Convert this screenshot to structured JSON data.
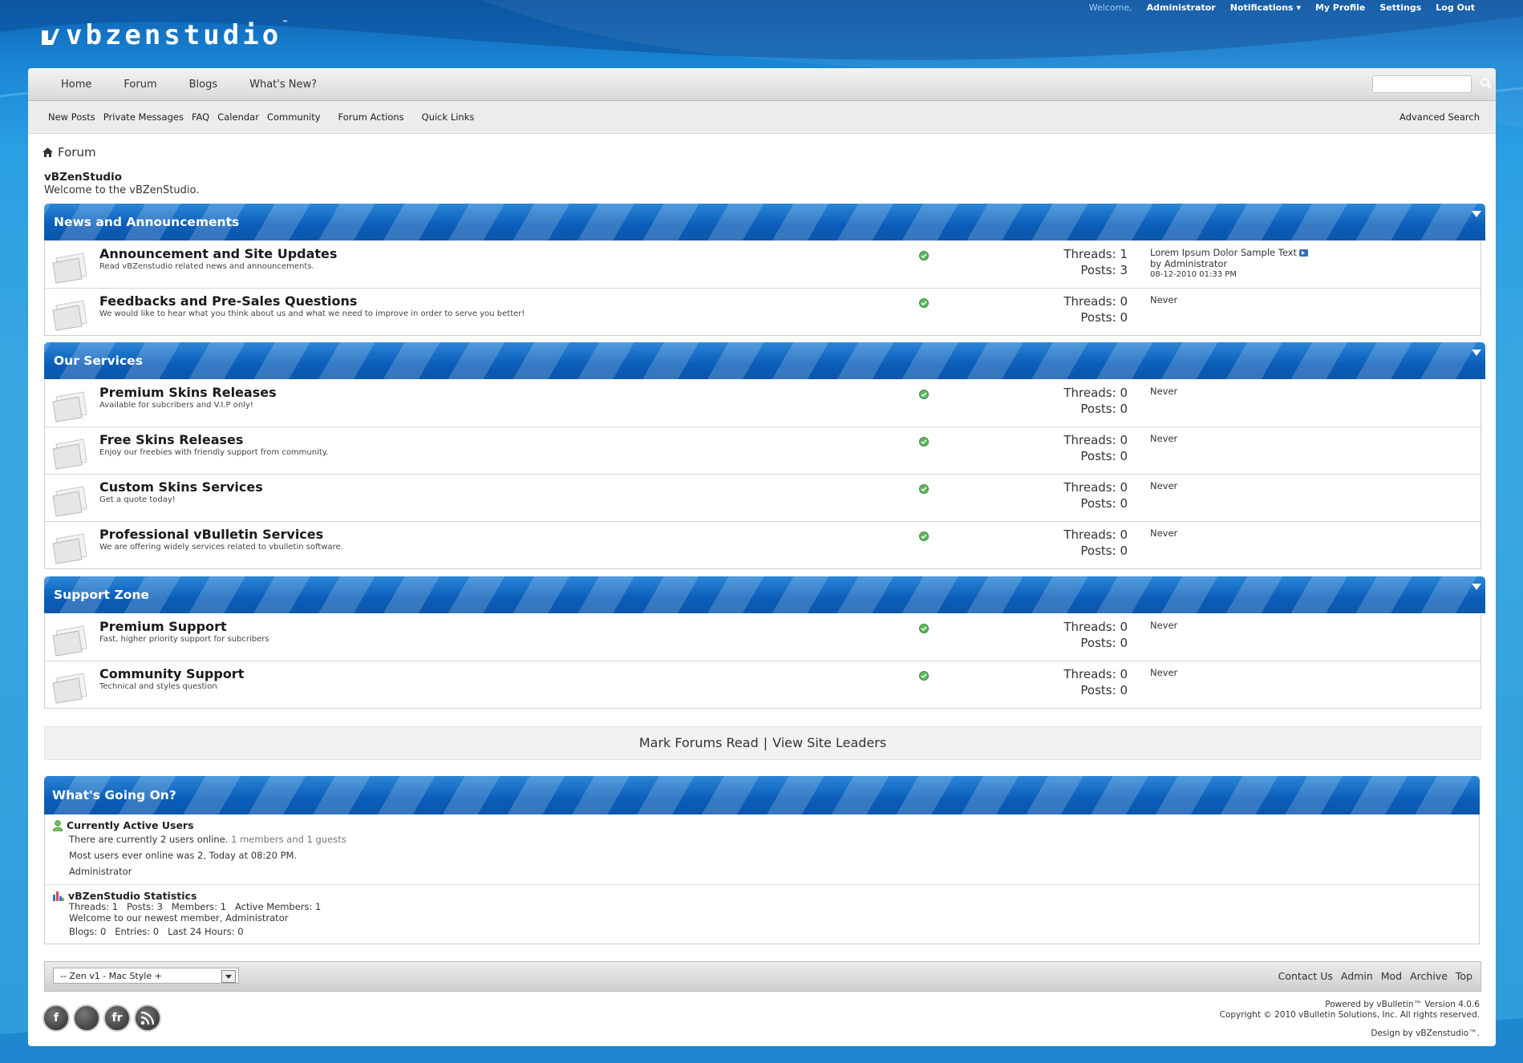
{
  "colors": {
    "brand_blue": "#0a5db9",
    "background": "#2a9fe3",
    "online_green": "#4caf50"
  },
  "top": {
    "welcome": "Welcome,",
    "user": "Administrator",
    "notifications": "Notifications",
    "profile": "My Profile",
    "settings": "Settings",
    "logout": "Log Out"
  },
  "logo": {
    "text": "vbzenstudio",
    "tm": "™"
  },
  "nav": {
    "tabs": [
      "Home",
      "Forum",
      "Blogs",
      "What's New?"
    ]
  },
  "subnav": {
    "links": [
      "New Posts",
      "Private Messages",
      "FAQ",
      "Calendar",
      "Community",
      "Forum Actions",
      "Quick Links"
    ],
    "advanced": "Advanced Search"
  },
  "breadcrumb": {
    "label": "Forum"
  },
  "site": {
    "name": "vBZenStudio",
    "welcome": "Welcome to the vBZenStudio."
  },
  "categories": [
    {
      "title": "News and Announcements",
      "forums": [
        {
          "name": "Announcement and Site Updates",
          "desc": "Read vBZenstudio related news and announcements.",
          "threads": "Threads: 1",
          "posts": "Posts: 3",
          "last_title": "Lorem Ipsum Dolor Sample Text",
          "last_by": "by Administrator",
          "last_date": "08-12-2010 01:33 PM"
        },
        {
          "name": "Feedbacks and Pre-Sales Questions",
          "desc": "We would like to hear what you think about us and what we need to improve in order to serve you better!",
          "threads": "Threads: 0",
          "posts": "Posts: 0",
          "last_title": "Never"
        }
      ]
    },
    {
      "title": "Our Services",
      "forums": [
        {
          "name": "Premium Skins Releases",
          "desc": "Available for subcribers and V.I.P only!",
          "threads": "Threads: 0",
          "posts": "Posts: 0",
          "last_title": "Never"
        },
        {
          "name": "Free Skins Releases",
          "desc": "Enjoy our freebies with friendly support from community.",
          "threads": "Threads: 0",
          "posts": "Posts: 0",
          "last_title": "Never"
        },
        {
          "name": "Custom Skins Services",
          "desc": "Get a quote today!",
          "threads": "Threads: 0",
          "posts": "Posts: 0",
          "last_title": "Never"
        },
        {
          "name": "Professional vBulletin Services",
          "desc": "We are offering widely services related to vbulletin software.",
          "threads": "Threads: 0",
          "posts": "Posts: 0",
          "last_title": "Never"
        }
      ]
    },
    {
      "title": "Support Zone",
      "forums": [
        {
          "name": "Premium Support",
          "desc": "Fast, higher priority support for subcribers",
          "threads": "Threads: 0",
          "posts": "Posts: 0",
          "last_title": "Never"
        },
        {
          "name": "Community Support",
          "desc": "Technical and styles question",
          "threads": "Threads: 0",
          "posts": "Posts: 0",
          "last_title": "Never"
        }
      ]
    }
  ],
  "actions": {
    "mark": "Mark Forums Read",
    "sep": "|",
    "leaders": "View Site Leaders"
  },
  "wgo": {
    "title": "What's Going On?",
    "active": {
      "head": "Currently Active Users",
      "line1a": "There are currently 2 users online.",
      "line1b": "1 members and 1 guests",
      "line2": "Most users ever online was 2, Today at 08:20 PM.",
      "line3": "Administrator"
    },
    "stats": {
      "head": "vBZenStudio Statistics",
      "line1": "Threads: 1   Posts: 3   Members: 1   Active Members: 1",
      "line2": "Welcome to our newest member, Administrator",
      "line3": "Blogs: 0   Entries: 0   Last 24 Hours: 0"
    }
  },
  "footer": {
    "style": "-- Zen v1 - Mac Style +",
    "links": [
      "Contact Us",
      "Admin",
      "Mod",
      "Archive",
      "Top"
    ]
  },
  "social": [
    "f",
    "",
    "fr",
    ""
  ],
  "copyright": {
    "l1": "Powered by vBulletin™ Version 4.0.6",
    "l2": "Copyright © 2010 vBulletin Solutions, Inc. All rights reserved.",
    "l3": "Design by vBZenstudio™."
  }
}
